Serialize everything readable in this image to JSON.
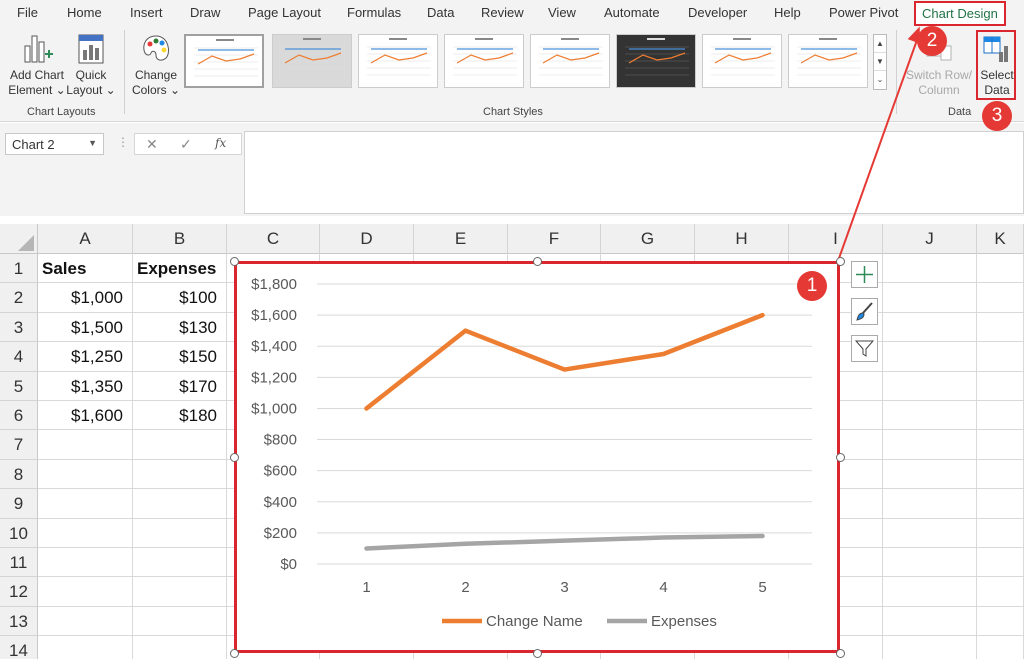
{
  "ribbon_tabs": [
    "File",
    "Home",
    "Insert",
    "Draw",
    "Page Layout",
    "Formulas",
    "Data",
    "Review",
    "View",
    "Automate",
    "Developer",
    "Help",
    "Power Pivot",
    "Chart Design"
  ],
  "ribbon": {
    "add_chart_element": [
      "Add Chart",
      "Element ⌄"
    ],
    "quick_layout": [
      "Quick",
      "Layout ⌄"
    ],
    "change_colors": [
      "Change",
      "Colors ⌄"
    ],
    "switch_row_column": [
      "Switch Row/",
      "Column"
    ],
    "select_data": [
      "Select",
      "Data"
    ],
    "groups": {
      "chart_layouts": "Chart Layouts",
      "chart_styles": "Chart Styles",
      "data": "Data"
    }
  },
  "formula_bar": {
    "name_box": "Chart 2",
    "cancel": "✕",
    "enter": "✓",
    "fx": "fx",
    "value": ""
  },
  "columns": [
    "A",
    "B",
    "C",
    "D",
    "E",
    "F",
    "G",
    "H",
    "I",
    "J",
    "K"
  ],
  "rows": [
    "1",
    "2",
    "3",
    "4",
    "5",
    "6",
    "7",
    "8",
    "9",
    "10",
    "11",
    "12",
    "13",
    "14"
  ],
  "cells": {
    "A": [
      "Sales",
      "$1,000",
      "$1,500",
      "$1,250",
      "$1,350",
      "$1,600"
    ],
    "B": [
      "Expenses",
      "$100",
      "$130",
      "$150",
      "$170",
      "$180"
    ]
  },
  "chart_data": {
    "type": "line",
    "categories": [
      "1",
      "2",
      "3",
      "4",
      "5"
    ],
    "series": [
      {
        "name": "Change Name",
        "values": [
          1000,
          1500,
          1250,
          1350,
          1600
        ],
        "color": "#ed7d31"
      },
      {
        "name": "Expenses",
        "values": [
          100,
          130,
          150,
          170,
          180
        ],
        "color": "#a5a5a5"
      }
    ],
    "y_ticks": [
      "$0",
      "$200",
      "$400",
      "$600",
      "$800",
      "$1,000",
      "$1,200",
      "$1,400",
      "$1,600",
      "$1,800"
    ],
    "ylim": [
      0,
      1800
    ],
    "grid": true,
    "legend": "bottom"
  },
  "annotations": [
    "1",
    "2",
    "3"
  ],
  "colors": {
    "excel_green": "#217346",
    "highlight_red": "#d9262f",
    "badge_red": "#e53935"
  }
}
